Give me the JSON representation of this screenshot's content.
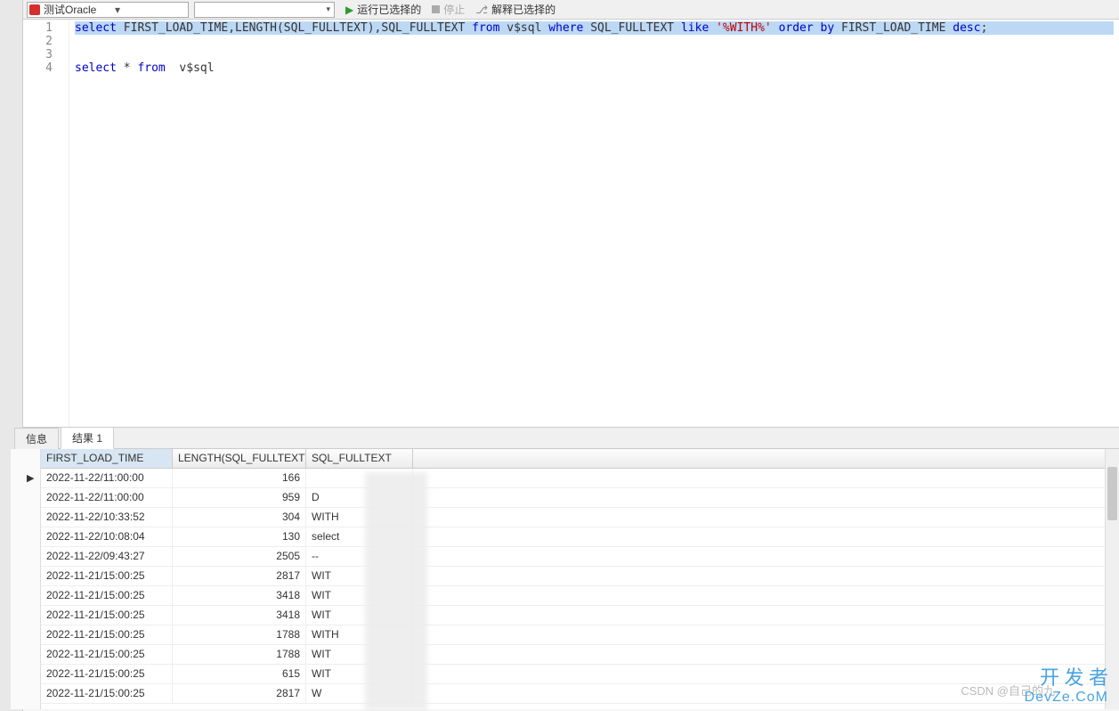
{
  "toolbar": {
    "connection_name": "测试Oracle",
    "run_label": "运行已选择的",
    "stop_label": "停止",
    "explain_label": "解释已选择的"
  },
  "editor": {
    "lines": [
      {
        "raw": [
          {
            "t": "select ",
            "c": "kw"
          },
          {
            "t": "FIRST_LOAD_TIME,LENGTH(SQL_FULLTEXT),SQL_FULLTEXT ",
            "c": "ident"
          },
          {
            "t": "from ",
            "c": "kw"
          },
          {
            "t": "v$sql ",
            "c": "ident"
          },
          {
            "t": "where ",
            "c": "kw"
          },
          {
            "t": "SQL_FULLTEXT ",
            "c": "ident"
          },
          {
            "t": "like ",
            "c": "kw"
          },
          {
            "t": "'%WITH%' ",
            "c": "str"
          },
          {
            "t": "order by ",
            "c": "kw"
          },
          {
            "t": "FIRST_LOAD_TIME ",
            "c": "ident"
          },
          {
            "t": "desc",
            "c": "kw"
          },
          {
            "t": ";",
            "c": "ident"
          }
        ],
        "hl": true
      },
      {
        "raw": [],
        "hl": false
      },
      {
        "raw": [],
        "hl": false
      },
      {
        "raw": [
          {
            "t": "select ",
            "c": "kw"
          },
          {
            "t": "* ",
            "c": "ident"
          },
          {
            "t": "from  ",
            "c": "kw"
          },
          {
            "t": "v$sql",
            "c": "ident"
          }
        ],
        "hl": false
      }
    ]
  },
  "tabs": {
    "info": "信息",
    "result": "结果 1"
  },
  "results": {
    "columns": [
      "FIRST_LOAD_TIME",
      "LENGTH(SQL_FULLTEXT)",
      "SQL_FULLTEXT"
    ],
    "rows": [
      {
        "time": "2022-11-22/11:00:00",
        "len": "166",
        "sql": ""
      },
      {
        "time": "2022-11-22/11:00:00",
        "len": "959",
        "sql": "D"
      },
      {
        "time": "2022-11-22/10:33:52",
        "len": "304",
        "sql": "WITH"
      },
      {
        "time": "2022-11-22/10:08:04",
        "len": "130",
        "sql": "select"
      },
      {
        "time": "2022-11-22/09:43:27",
        "len": "2505",
        "sql": "--"
      },
      {
        "time": "2022-11-21/15:00:25",
        "len": "2817",
        "sql": "WIT"
      },
      {
        "time": "2022-11-21/15:00:25",
        "len": "3418",
        "sql": "WIT"
      },
      {
        "time": "2022-11-21/15:00:25",
        "len": "3418",
        "sql": "WIT"
      },
      {
        "time": "2022-11-21/15:00:25",
        "len": "1788",
        "sql": "WITH"
      },
      {
        "time": "2022-11-21/15:00:25",
        "len": "1788",
        "sql": "WIT"
      },
      {
        "time": "2022-11-21/15:00:25",
        "len": "615",
        "sql": "WIT"
      },
      {
        "time": "2022-11-21/15:00:25",
        "len": "2817",
        "sql": "W"
      }
    ]
  },
  "watermark": {
    "csdn": "CSDN @自己的九",
    "logo_top": "开 发 者",
    "logo_bottom": "DevZe.CoM"
  }
}
